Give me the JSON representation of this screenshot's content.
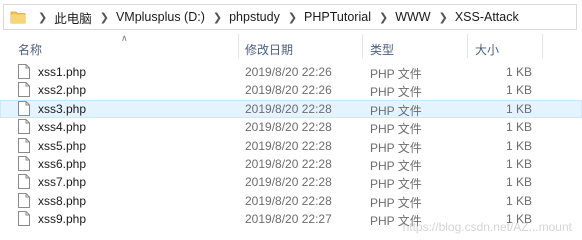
{
  "address_bar": {
    "folder_icon": "folder-icon",
    "crumbs": [
      "此电脑",
      "VMplusplus (D:)",
      "phpstudy",
      "PHPTutorial",
      "WWW",
      "XSS-Attack"
    ]
  },
  "columns": {
    "name": "名称",
    "modified": "修改日期",
    "type": "类型",
    "size": "大小"
  },
  "files": [
    {
      "name": "xss1.php",
      "modified": "2019/8/20 22:26",
      "type": "PHP 文件",
      "size": "1 KB",
      "selected": false
    },
    {
      "name": "xss2.php",
      "modified": "2019/8/20 22:26",
      "type": "PHP 文件",
      "size": "1 KB",
      "selected": false
    },
    {
      "name": "xss3.php",
      "modified": "2019/8/20 22:28",
      "type": "PHP 文件",
      "size": "1 KB",
      "selected": true
    },
    {
      "name": "xss4.php",
      "modified": "2019/8/20 22:28",
      "type": "PHP 文件",
      "size": "1 KB",
      "selected": false
    },
    {
      "name": "xss5.php",
      "modified": "2019/8/20 22:28",
      "type": "PHP 文件",
      "size": "1 KB",
      "selected": false
    },
    {
      "name": "xss6.php",
      "modified": "2019/8/20 22:28",
      "type": "PHP 文件",
      "size": "1 KB",
      "selected": false
    },
    {
      "name": "xss7.php",
      "modified": "2019/8/20 22:28",
      "type": "PHP 文件",
      "size": "1 KB",
      "selected": false
    },
    {
      "name": "xss8.php",
      "modified": "2019/8/20 22:28",
      "type": "PHP 文件",
      "size": "1 KB",
      "selected": false
    },
    {
      "name": "xss9.php",
      "modified": "2019/8/20 22:27",
      "type": "PHP 文件",
      "size": "1 KB",
      "selected": false
    }
  ],
  "watermark": "https://blog.csdn.net/AZ...mount",
  "colors": {
    "selection": "#e5f3ff",
    "header_text": "#4d6082",
    "folder": "#f2c54b"
  }
}
